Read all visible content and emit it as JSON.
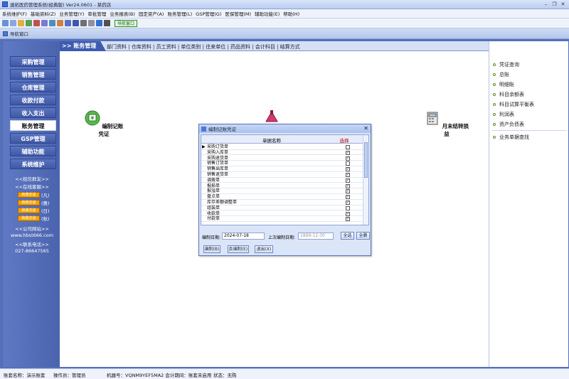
{
  "window": {
    "title": "速拓医药管理系统(经典版) Ver24.0601 - 某药店"
  },
  "menu": [
    "系统维护(F)",
    "基础资料(Z)",
    "业务管理(Y)",
    "审批管理",
    "业务报表(B)",
    "固定资产(A)",
    "账务管理(L)",
    "GSP管理(G)",
    "医保管理(M)",
    "辅助功能(E)",
    "帮助(H)"
  ],
  "toolbar": {
    "nav_button": "导航窗口"
  },
  "subwindow": {
    "title": "导航窗口"
  },
  "leftnav": {
    "items": [
      "采购管理",
      "销售管理",
      "仓库管理",
      "收款付款",
      "收入支出",
      "账务管理",
      "GSP管理",
      "辅助功能",
      "系统维护"
    ],
    "active": "账务管理",
    "recruit": "<<招信群友>>",
    "online_support": "<<在线客服>>",
    "qq": [
      "(凡)",
      "(惠)",
      "(日)",
      "(秋)"
    ],
    "qq_badge": "和我交谈",
    "company_site": "<<公司网站>>",
    "website": "www.hbst666.com",
    "contact": "<<联系电话>>",
    "phone": "027-86647565"
  },
  "tabs": {
    "active": ">> 账务管理",
    "items": "部门资料 | 仓库资料 | 员工资料 | 单位类别 | 往来单位 | 药品资料 | 会计科目 | 结算方式"
  },
  "functions": {
    "voucher": "编制记账凭证",
    "month_end": "月末结转损益"
  },
  "rightpanel": {
    "items": [
      "凭证查询",
      "总账",
      "明细账",
      "科目余额表",
      "科目试算平衡表",
      "利润表",
      "资产负债表"
    ],
    "bottom": "业务单据查找"
  },
  "dialog": {
    "title": "编制记账凭证",
    "col_name": "单据名称",
    "col_select": "选择",
    "rows": [
      {
        "name": "采购订货单",
        "checked": false
      },
      {
        "name": "采购入库单",
        "checked": true
      },
      {
        "name": "采购退货单",
        "checked": true
      },
      {
        "name": "销售订货单",
        "checked": false
      },
      {
        "name": "销售出库单",
        "checked": true
      },
      {
        "name": "销售退货单",
        "checked": true
      },
      {
        "name": "调拨单",
        "checked": true
      },
      {
        "name": "报损单",
        "checked": true
      },
      {
        "name": "报溢单",
        "checked": true
      },
      {
        "name": "盘点单",
        "checked": true
      },
      {
        "name": "库存差额调整单",
        "checked": true
      },
      {
        "name": "组装单",
        "checked": false
      },
      {
        "name": "收款单",
        "checked": true
      },
      {
        "name": "付款单",
        "checked": true
      }
    ],
    "date_label": "编制日期:",
    "date_value": "2024-07-18",
    "last_label": "上次编制日期:",
    "last_value": "1899-12-30",
    "btn_select_all": "全选",
    "btn_deselect": "全删",
    "btn_compile": "编制(B)",
    "btn_reverse": "反编制(E)",
    "btn_exit": "退出(X)"
  },
  "status": {
    "account": "账套名称：演示账套",
    "operator": "操作员：管理员",
    "machine": "机器号：VQNM9YEF5MA2 会计期间：账套未启用",
    "state": "状态：无购"
  }
}
